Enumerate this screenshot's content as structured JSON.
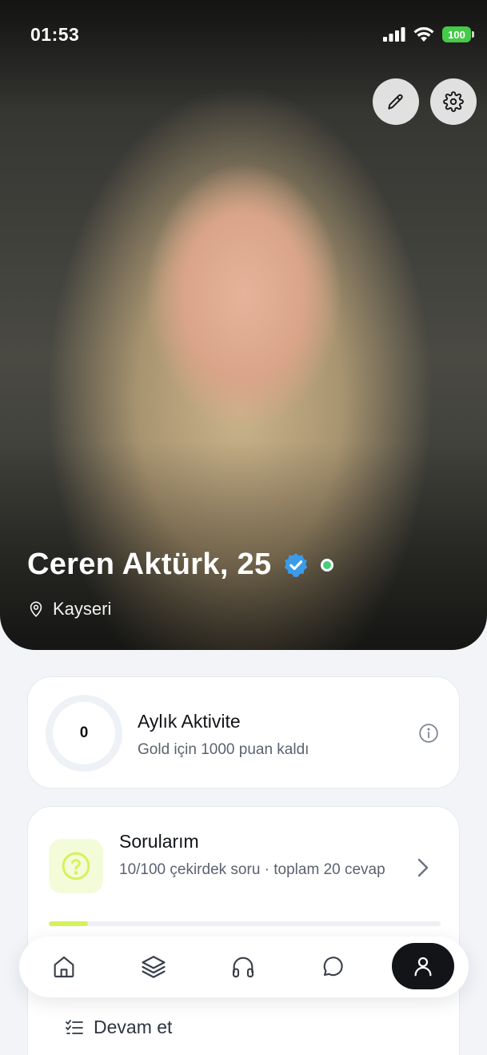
{
  "status_bar": {
    "time": "01:53",
    "battery": "100",
    "icons": [
      "signal-icon",
      "wifi-icon",
      "battery-icon"
    ]
  },
  "profile": {
    "name": "Ceren Aktürk, 25",
    "verified": true,
    "online": true,
    "location": "Kayseri",
    "actions": [
      "edit-icon",
      "settings-icon"
    ]
  },
  "activity_card": {
    "score": "0",
    "title": "Aylık Aktivite",
    "subtitle": "Gold için 1000 puan kaldı"
  },
  "questions_card": {
    "title": "Sorularım",
    "subtitle": "10/100 çekirdek soru · toplam 20 cevap",
    "progress": 0.1,
    "continue_label": "Devam et"
  },
  "bottom_nav": {
    "items": [
      "home-icon",
      "layers-icon",
      "headphones-icon",
      "chat-icon",
      "profile-icon"
    ],
    "active": "profile-icon"
  },
  "colors": {
    "accent_lime": "#d6f25a",
    "verified_blue": "#3b9be8",
    "online_green": "#3fd07a",
    "battery_green": "#47c94a"
  }
}
